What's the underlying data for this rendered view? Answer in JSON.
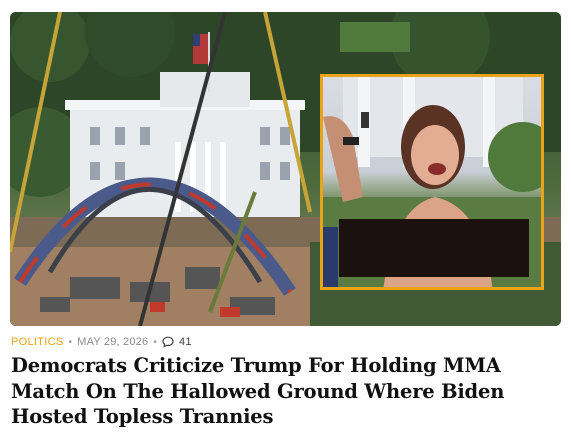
{
  "article": {
    "category": "POLITICS",
    "date": "MAY 29, 2026",
    "comment_count": "41",
    "separator": "•",
    "headline": "Democrats Criticize Trump For Holding MMA Match On The Hallowed Ground Where Biden Hosted Topless Trannies"
  },
  "icons": {
    "comments": "comment-bubble-icon"
  },
  "colors": {
    "category": "#e8a317",
    "inset_border": "#e8a317",
    "meta_text": "#8a8a8a",
    "headline_text": "#111111",
    "censor_bar": "#1b1210"
  }
}
